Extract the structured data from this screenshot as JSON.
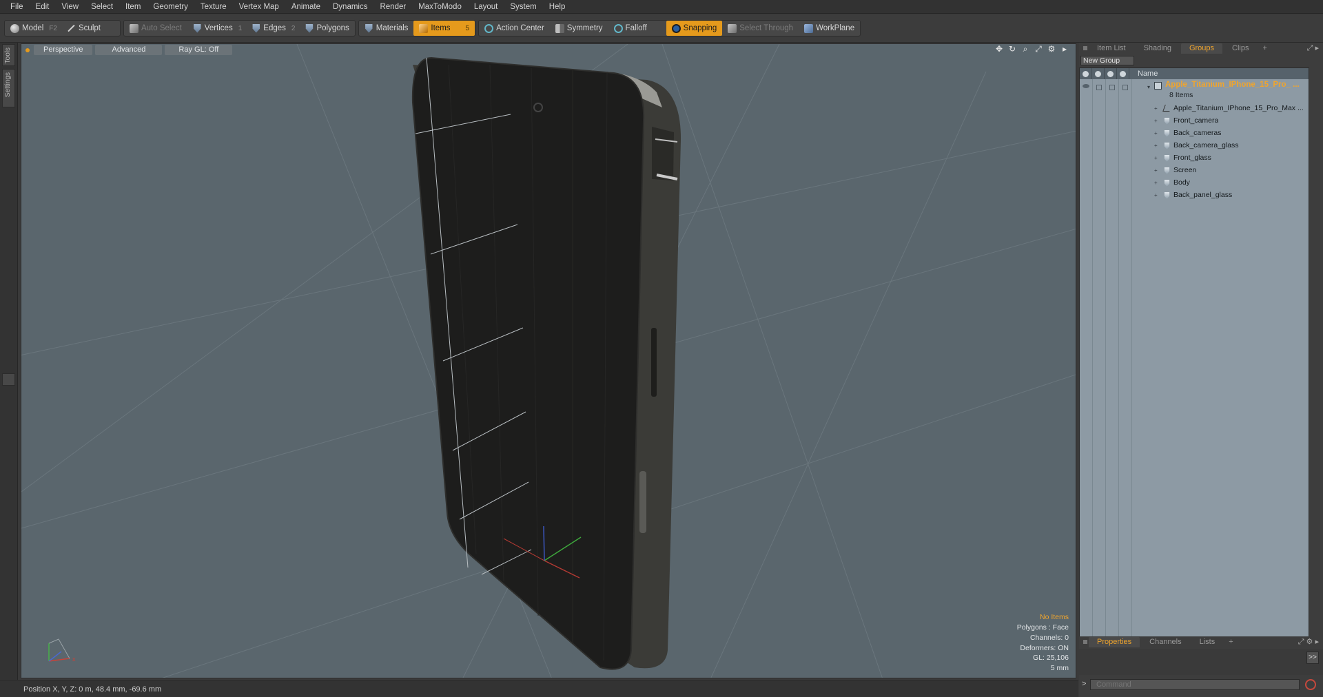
{
  "menu": [
    "File",
    "Edit",
    "View",
    "Select",
    "Item",
    "Geometry",
    "Texture",
    "Vertex Map",
    "Animate",
    "Dynamics",
    "Render",
    "MaxToModo",
    "Layout",
    "System",
    "Help"
  ],
  "toolbar": {
    "model": "Model",
    "model_key": "F2",
    "sculpt": "Sculpt",
    "auto_select": "Auto Select",
    "vertices": "Vertices",
    "vertices_key": "1",
    "edges": "Edges",
    "edges_key": "2",
    "polygons": "Polygons",
    "materials": "Materials",
    "items": "Items",
    "items_key": "5",
    "action_center": "Action Center",
    "symmetry": "Symmetry",
    "falloff": "Falloff",
    "snapping": "Snapping",
    "select_through": "Select Through",
    "workplane": "WorkPlane",
    "accent_color": "#e59a1c"
  },
  "left_tabs": [
    "Tools",
    "Settings"
  ],
  "viewport": {
    "view_mode": "Perspective",
    "shading": "Advanced",
    "raygl": "Ray GL: Off",
    "info": {
      "items": "No Items",
      "polygons": "Polygons : Face",
      "channels": "Channels: 0",
      "deformers": "Deformers: ON",
      "gl": "GL: 25,106",
      "scale": "5 mm"
    }
  },
  "status": {
    "position": "Position X, Y, Z:  0 m, 48.4 mm, -69.6 mm"
  },
  "right_panel": {
    "tabs": [
      "Item List",
      "Shading",
      "Groups",
      "Clips"
    ],
    "active_tab": "Groups",
    "new_group": "New Group",
    "column_name": "Name",
    "group_name": "Apple_Titanium_IPhone_15_Pro_ ...",
    "group_count": "8 Items",
    "items": [
      "Apple_Titanium_IPhone_15_Pro_Max ...",
      "Front_camera",
      "Back_cameras",
      "Back_camera_glass",
      "Front_glass",
      "Screen",
      "Body",
      "Back_panel_glass"
    ],
    "bottom_tabs": [
      "Properties",
      "Channels",
      "Lists"
    ],
    "bottom_active": "Properties",
    "command_placeholder": "Command"
  }
}
